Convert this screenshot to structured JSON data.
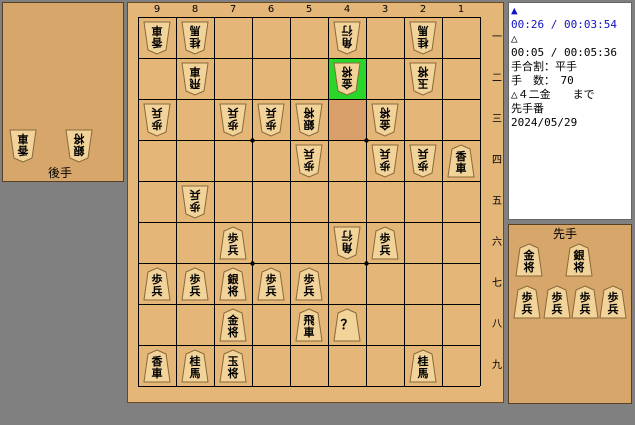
{
  "info": {
    "sente_mark": "▲",
    "sente_time": "00:26 / 00:03:54",
    "gote_mark": "△",
    "gote_time": "00:05 / 00:05:36",
    "handicap": "手合割：平手",
    "moves": "手　数：　70",
    "last_move": "△４二金　　まで",
    "turn": "先手番",
    "date": "2024/05/29"
  },
  "gote_stand": {
    "label": "後手",
    "pieces": [
      [
        "香",
        "車"
      ],
      [
        "銀",
        "将"
      ]
    ]
  },
  "sente_stand": {
    "label": "先手",
    "pieces": [
      [
        "金",
        "将"
      ],
      [
        "銀",
        "将"
      ],
      [
        "歩",
        "兵"
      ],
      [
        "歩",
        "兵"
      ],
      [
        "歩",
        "兵"
      ],
      [
        "歩",
        "兵"
      ]
    ]
  },
  "files": [
    "9",
    "8",
    "7",
    "6",
    "5",
    "4",
    "3",
    "2",
    "1"
  ],
  "ranks": [
    "一",
    "二",
    "三",
    "四",
    "五",
    "六",
    "七",
    "八",
    "九"
  ],
  "highlight": {
    "file": 4,
    "rank": 2,
    "color": "#2bd62b"
  },
  "last_move_sq": {
    "file": 4,
    "rank": 3,
    "color": "#d89f6a"
  },
  "pieces": [
    {
      "f": 9,
      "r": 1,
      "s": "g",
      "t": [
        "香",
        "車"
      ]
    },
    {
      "f": 8,
      "r": 1,
      "s": "g",
      "t": [
        "桂",
        "馬"
      ]
    },
    {
      "f": 4,
      "r": 1,
      "s": "g",
      "t": [
        "角",
        "行"
      ]
    },
    {
      "f": 2,
      "r": 1,
      "s": "g",
      "t": [
        "桂",
        "馬"
      ]
    },
    {
      "f": 8,
      "r": 2,
      "s": "g",
      "t": [
        "飛",
        "車"
      ]
    },
    {
      "f": 4,
      "r": 2,
      "s": "g",
      "t": [
        "金",
        "将"
      ]
    },
    {
      "f": 2,
      "r": 2,
      "s": "g",
      "t": [
        "玉",
        "将"
      ]
    },
    {
      "f": 9,
      "r": 3,
      "s": "g",
      "t": [
        "歩",
        "兵"
      ]
    },
    {
      "f": 7,
      "r": 3,
      "s": "g",
      "t": [
        "歩",
        "兵"
      ]
    },
    {
      "f": 6,
      "r": 3,
      "s": "g",
      "t": [
        "歩",
        "兵"
      ]
    },
    {
      "f": 5,
      "r": 3,
      "s": "g",
      "t": [
        "銀",
        "将"
      ]
    },
    {
      "f": 3,
      "r": 3,
      "s": "g",
      "t": [
        "金",
        "将"
      ]
    },
    {
      "f": 5,
      "r": 4,
      "s": "g",
      "t": [
        "歩",
        "兵"
      ]
    },
    {
      "f": 3,
      "r": 4,
      "s": "g",
      "t": [
        "歩",
        "兵"
      ]
    },
    {
      "f": 2,
      "r": 4,
      "s": "g",
      "t": [
        "歩",
        "兵"
      ]
    },
    {
      "f": 1,
      "r": 4,
      "s": "s",
      "t": [
        "香",
        "車"
      ]
    },
    {
      "f": 8,
      "r": 5,
      "s": "g",
      "t": [
        "歩",
        "兵"
      ]
    },
    {
      "f": 7,
      "r": 6,
      "s": "s",
      "t": [
        "歩",
        "兵"
      ]
    },
    {
      "f": 4,
      "r": 6,
      "s": "g",
      "t": [
        "角",
        "行"
      ]
    },
    {
      "f": 3,
      "r": 6,
      "s": "s",
      "t": [
        "歩",
        "兵"
      ]
    },
    {
      "f": 9,
      "r": 7,
      "s": "s",
      "t": [
        "歩",
        "兵"
      ]
    },
    {
      "f": 8,
      "r": 7,
      "s": "s",
      "t": [
        "歩",
        "兵"
      ]
    },
    {
      "f": 7,
      "r": 7,
      "s": "s",
      "t": [
        "銀",
        "将"
      ]
    },
    {
      "f": 6,
      "r": 7,
      "s": "s",
      "t": [
        "歩",
        "兵"
      ]
    },
    {
      "f": 5,
      "r": 7,
      "s": "s",
      "t": [
        "歩",
        "兵"
      ]
    },
    {
      "f": 7,
      "r": 8,
      "s": "s",
      "t": [
        "金",
        "将"
      ]
    },
    {
      "f": 5,
      "r": 8,
      "s": "s",
      "t": [
        "飛",
        "車"
      ]
    },
    {
      "f": 4,
      "r": 8,
      "s": "s",
      "t": [
        "？",
        ""
      ]
    },
    {
      "f": 9,
      "r": 9,
      "s": "s",
      "t": [
        "香",
        "車"
      ]
    },
    {
      "f": 8,
      "r": 9,
      "s": "s",
      "t": [
        "桂",
        "馬"
      ]
    },
    {
      "f": 7,
      "r": 9,
      "s": "s",
      "t": [
        "玉",
        "将"
      ]
    },
    {
      "f": 2,
      "r": 9,
      "s": "s",
      "t": [
        "桂",
        "馬"
      ]
    }
  ]
}
